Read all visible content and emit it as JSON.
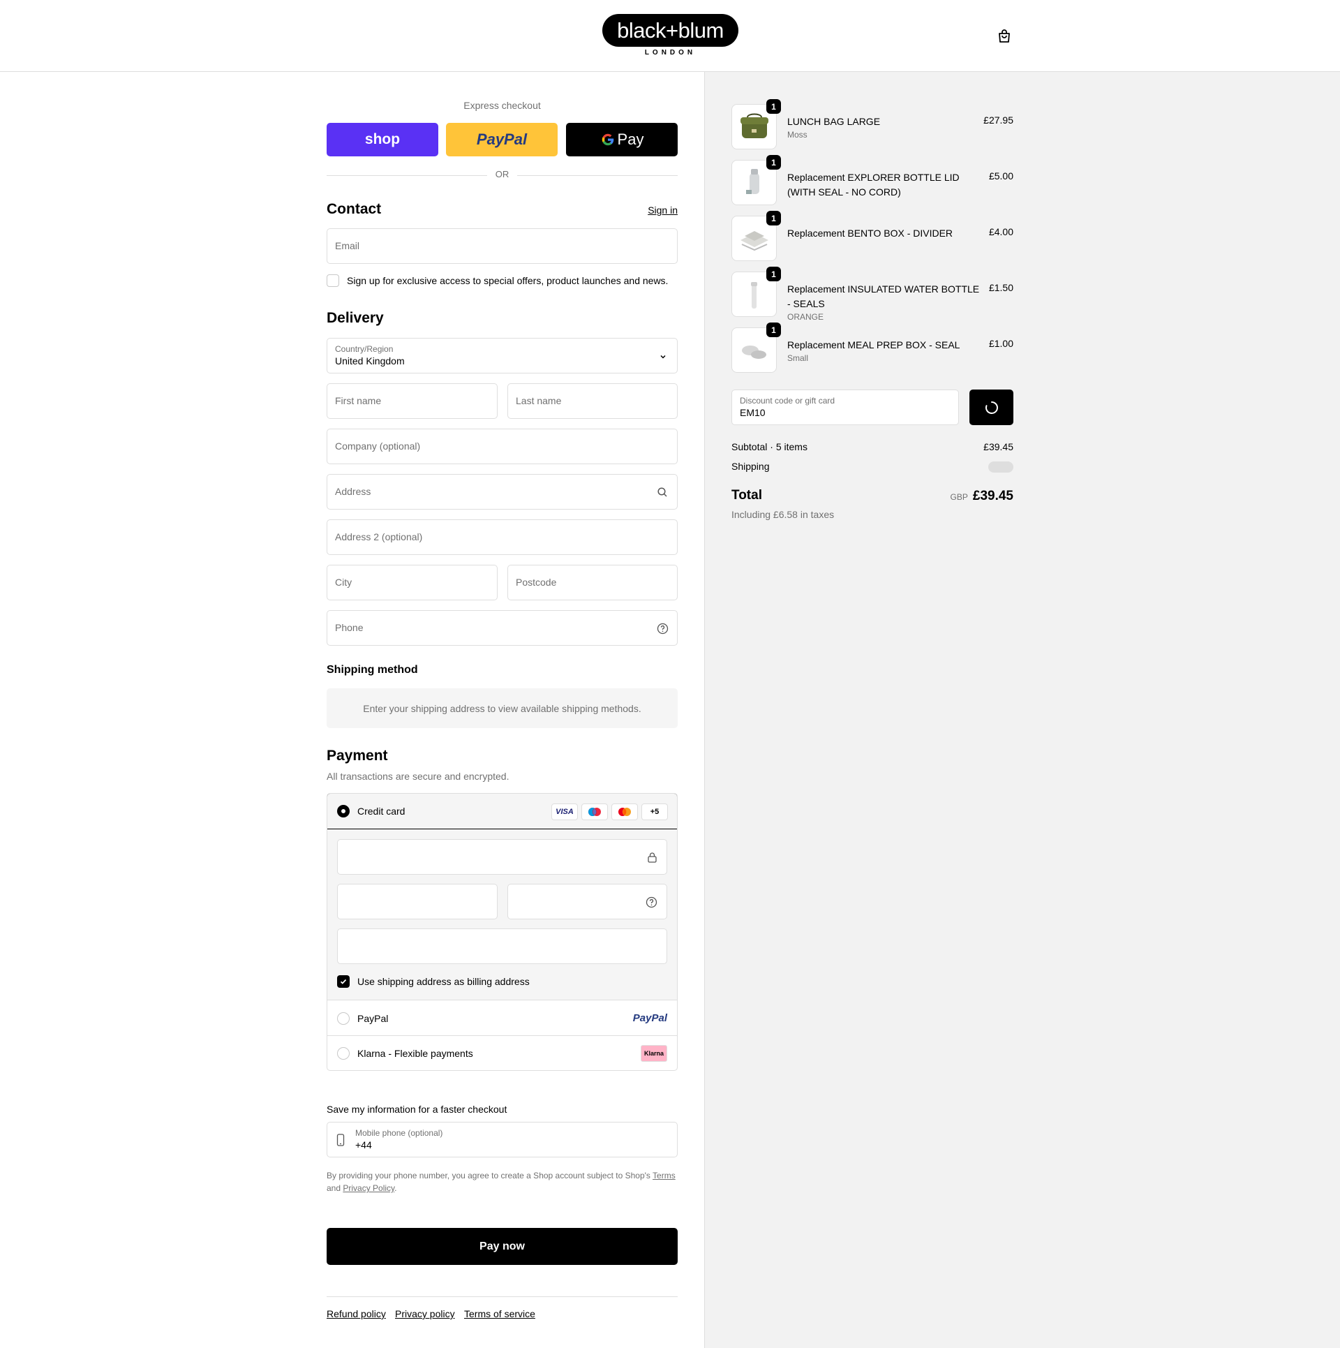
{
  "header": {
    "logo_main": "black+blum",
    "logo_sub": "LONDON",
    "cart_icon": "shopping-bag-icon"
  },
  "express": {
    "title": "Express checkout",
    "shop_label": "shop",
    "paypal_label": "PayPal",
    "gpay_label": "Pay",
    "or_label": "OR"
  },
  "contact": {
    "title": "Contact",
    "sign_in": "Sign in",
    "email_placeholder": "Email",
    "newsletter_label": "Sign up for exclusive access to special offers, product launches and news."
  },
  "delivery": {
    "title": "Delivery",
    "country_label": "Country/Region",
    "country_value": "United Kingdom",
    "first_name": "First name",
    "last_name": "Last name",
    "company": "Company (optional)",
    "address": "Address",
    "address2": "Address 2 (optional)",
    "city": "City",
    "postcode": "Postcode",
    "phone": "Phone"
  },
  "shipping_method": {
    "title": "Shipping method",
    "notice": "Enter your shipping address to view available shipping methods."
  },
  "payment": {
    "title": "Payment",
    "subtitle": "All transactions are secure and encrypted.",
    "credit_card_label": "Credit card",
    "card_brands": [
      "VISA",
      "Maestro",
      "Mastercard",
      "+5"
    ],
    "billing_label": "Use shipping address as billing address",
    "billing_checked": true,
    "paypal_label": "PayPal",
    "paypal_logo": "PayPal",
    "klarna_label": "Klarna - Flexible payments",
    "klarna_logo": "Klarna"
  },
  "save_info": {
    "title": "Save my information for a faster checkout",
    "mobile_label": "Mobile phone (optional)",
    "mobile_value": "+44",
    "legal_prefix": "By providing your phone number, you agree to create a Shop account subject to Shop's ",
    "terms_link": "Terms",
    "legal_and": "and ",
    "privacy_link": "Privacy Policy",
    "legal_suffix": "."
  },
  "pay_now_label": "Pay now",
  "footer_links": [
    "Refund policy",
    "Privacy policy",
    "Terms of service"
  ],
  "order": {
    "items": [
      {
        "name": "LUNCH BAG LARGE",
        "variant": "Moss",
        "price": "£27.95",
        "qty": "1"
      },
      {
        "name": "Replacement EXPLORER BOTTLE LID (WITH SEAL - NO CORD)",
        "variant": "",
        "price": "£5.00",
        "qty": "1"
      },
      {
        "name": "Replacement BENTO BOX - DIVIDER",
        "variant": "",
        "price": "£4.00",
        "qty": "1"
      },
      {
        "name": "Replacement INSULATED WATER BOTTLE - SEALS",
        "variant": "ORANGE",
        "price": "£1.50",
        "qty": "1"
      },
      {
        "name": "Replacement MEAL PREP BOX - SEAL",
        "variant": "Small",
        "price": "£1.00",
        "qty": "1"
      }
    ],
    "discount_label": "Discount code or gift card",
    "discount_value": "EM10",
    "subtotal_label": "Subtotal · 5 items",
    "subtotal_value": "£39.45",
    "shipping_label": "Shipping",
    "total_label": "Total",
    "currency": "GBP",
    "total_value": "£39.45",
    "tax_note": "Including £6.58 in taxes"
  }
}
